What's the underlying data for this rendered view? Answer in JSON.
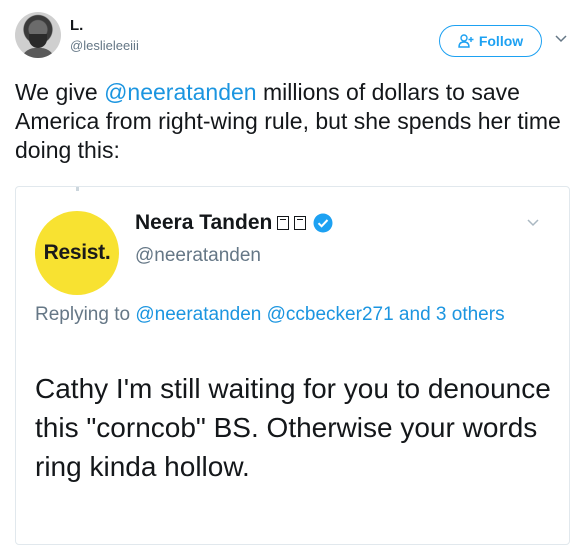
{
  "author": {
    "display_name": "L.",
    "handle": "@leslieleeiii"
  },
  "actions": {
    "follow_label": "Follow"
  },
  "tweet": {
    "text_before": "We give ",
    "mention": "@neeratanden",
    "text_after": " millions of dollars to save America from right-wing rule, but she spends her time doing this:"
  },
  "quoted": {
    "avatar_text": "Resist.",
    "display_name": "Neera Tanden",
    "handle": "@neeratanden",
    "replying_prefix": "Replying to ",
    "replying_mention_1": "@neeratanden",
    "replying_mention_2": "@ccbecker271",
    "replying_and": " and ",
    "replying_others": "3 others",
    "body": "Cathy I'm still waiting for you to denounce this \"corncob\" BS. Otherwise your words ring kinda hollow."
  },
  "colors": {
    "accent": "#1da1f2",
    "link": "#1b95e0",
    "secondary_text": "#657786",
    "resist_yellow": "#f8e231"
  }
}
